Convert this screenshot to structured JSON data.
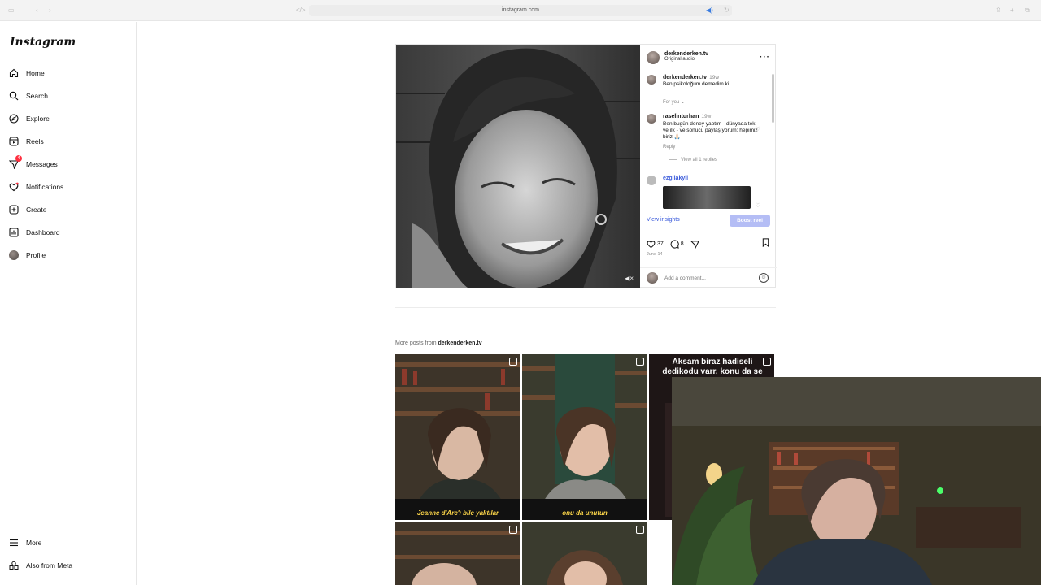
{
  "browser": {
    "url": "instagram.com"
  },
  "sidebar": {
    "logo": "Instagram",
    "items": [
      {
        "label": "Home"
      },
      {
        "label": "Search"
      },
      {
        "label": "Explore"
      },
      {
        "label": "Reels"
      },
      {
        "label": "Messages",
        "badge": "4"
      },
      {
        "label": "Notifications"
      },
      {
        "label": "Create"
      },
      {
        "label": "Dashboard"
      },
      {
        "label": "Profile"
      }
    ],
    "bottom": [
      {
        "label": "More"
      },
      {
        "label": "Also from Meta"
      }
    ]
  },
  "post": {
    "author": "derkenderken.tv",
    "audio": "Original audio",
    "caption_author": "derkenderken.tv",
    "caption_time": "19w",
    "caption_text": "Ben psikoloğum demedim ki...",
    "for_you": "For you",
    "comments": [
      {
        "user": "raselinturhan",
        "time": "19w",
        "text": "Ben bugün deney yaptım - dünyada tek ve ilk - ve sonucu paylaşıyorum: hepimiz biriz 🙏🏻",
        "reply": "Reply",
        "view_replies": "View all 1 replies"
      },
      {
        "user": "ezgiiakyll__"
      }
    ],
    "view_insights": "View insights",
    "boost": "Boost reel",
    "likes": "37",
    "comment_count": "8",
    "date": "June 14",
    "add_comment_placeholder": "Add a comment..."
  },
  "more_posts": {
    "prefix": "More posts from",
    "author": "derkenderken.tv",
    "tiles": [
      {
        "caption": "Jeanne d'Arc'ı bile yaktılar"
      },
      {
        "caption": "onu da unutun"
      },
      {
        "title": "Aksam biraz hadiseli dedikodu varr, konu da se"
      }
    ]
  },
  "colors": {
    "accent": "#3b5bdb",
    "boost_bg": "#b4bdf5",
    "badge": "#ff3040",
    "caption_yellow": "#ffd84a"
  }
}
